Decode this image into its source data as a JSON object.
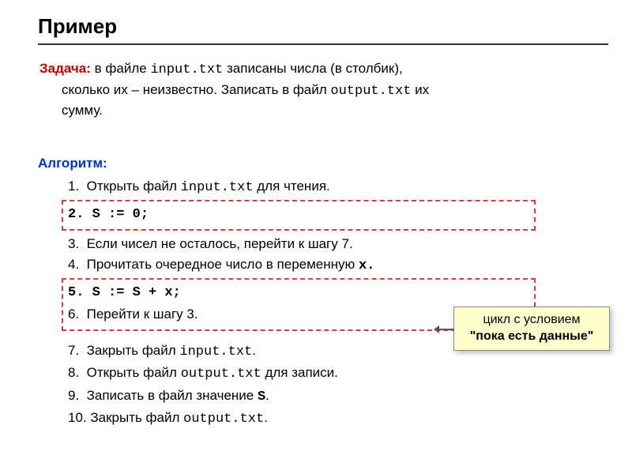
{
  "title": "Пример",
  "task": {
    "label": "Задача:",
    "line1_a": " в файле ",
    "file_in": "input.txt",
    "line1_b": " записаны числа (в столбик),",
    "line2_a": "сколько их – неизвестно. Записать в файл ",
    "file_out": "output.txt",
    "line2_b": " их",
    "line3": "сумму."
  },
  "algo_label": "Алгоритм:",
  "steps": {
    "s1_a": "1.  Открыть файл ",
    "s1_file": "input.txt",
    "s1_b": " для чтения.",
    "s2": "2. S := 0;",
    "s3": "3.  Если чисел не осталось, перейти к шагу 7.",
    "s4_a": "4.  Прочитать очередное число в переменную ",
    "s4_var": "x.",
    "s5": "5. S := S + x;",
    "s6": "6.  Перейти к шагу 3.",
    "s7_a": "7.  Закрыть файл ",
    "s7_file": "input.txt",
    "s7_b": ".",
    "s8_a": "8.  Открыть файл ",
    "s8_file": "output.txt",
    "s8_b": " для записи.",
    "s9_a": "9.  Записать в файл значение ",
    "s9_var": "S",
    "s9_b": ".",
    "s10_a": "10. Закрыть файл ",
    "s10_file": "output.txt",
    "s10_b": "."
  },
  "callout": {
    "line1": "цикл с условием",
    "line2": "\"пока есть данные\""
  }
}
